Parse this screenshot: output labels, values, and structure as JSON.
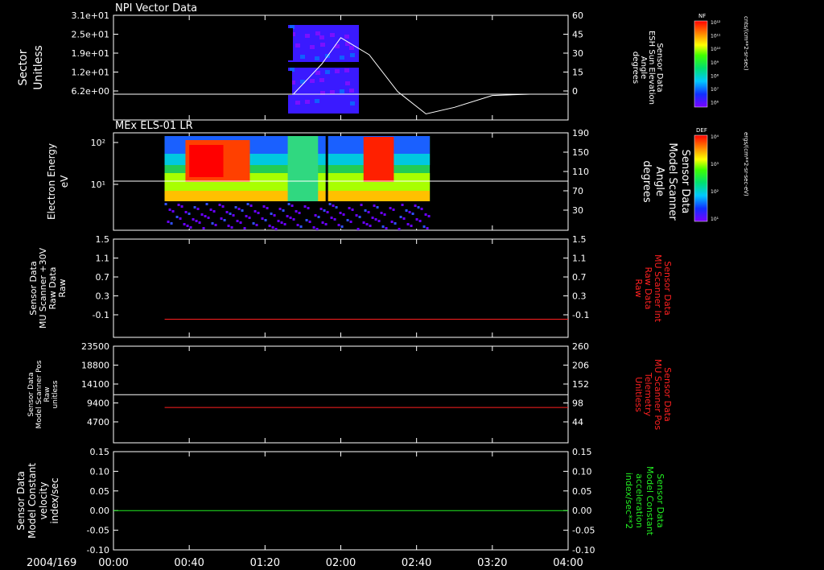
{
  "time_axis": {
    "date_label": "2004/169",
    "ticks": [
      "00:00",
      "00:40",
      "01:20",
      "02:00",
      "02:40",
      "03:20",
      "04:00"
    ]
  },
  "chart_data": [
    {
      "type": "heatmap",
      "title": "NPI Vector Data",
      "ylabel": [
        "Sector",
        "Unitless"
      ],
      "y_ticks": [
        "3.1e+01",
        "2.5e+01",
        "1.9e+01",
        "1.2e+01",
        "6.2e+00"
      ],
      "right_label": [
        "Sensor Data",
        "ESH Sun Elevation",
        "Angle",
        "degrees"
      ],
      "right_ticks": [
        "60",
        "45",
        "30",
        "15",
        "0"
      ],
      "right_ylim": [
        -20,
        60
      ],
      "overlay_series": [
        {
          "x": [
            "00:00",
            "01:35",
            "01:50",
            "02:00",
            "02:15",
            "02:30",
            "02:45",
            "03:00",
            "03:20",
            "03:40",
            "04:00"
          ],
          "y": [
            0,
            0,
            23,
            43,
            30,
            2,
            -15,
            -10,
            -1,
            0,
            0
          ]
        }
      ],
      "colorbar": {
        "label": "NF",
        "units": "cnts/(cm**2-sr-sec)",
        "ticks": [
          "10¹²",
          "10¹¹",
          "10¹⁰",
          "10⁹",
          "10⁸",
          "10⁷",
          "10⁶"
        ]
      }
    },
    {
      "type": "heatmap",
      "title": "MEx ELS-01 LR",
      "ylabel": [
        "Electron Energy",
        "eV"
      ],
      "y_ticks": [
        "10²",
        "10¹"
      ],
      "ylim": [
        1,
        200
      ],
      "right_label": [
        "Sensor Data",
        "Model Scanner",
        "Angle",
        "degrees"
      ],
      "right_ticks": [
        "190",
        "150",
        "110",
        "70",
        "30"
      ],
      "colorbar": {
        "label": "DEF",
        "units": "ergs/(cm**2-sr-sec-eV)",
        "ticks": [
          "10⁴",
          "10³",
          "10²",
          "10¹"
        ]
      }
    },
    {
      "type": "line",
      "ylabel": [
        "Sensor Data",
        "MU Scanner +30V",
        "Raw Data",
        "Raw"
      ],
      "y_ticks": [
        "1.5",
        "1.1",
        "0.7",
        "0.3",
        "-0.1"
      ],
      "ylim": [
        -0.4,
        1.5
      ],
      "right_label": [
        "Sensor Data",
        "MU Scanner Int",
        "Raw Data",
        "Raw"
      ],
      "right_ticks": [
        "1.5",
        "1.1",
        "0.7",
        "0.3",
        "-0.1"
      ],
      "series": [
        {
          "color": "#ff2020",
          "x": [
            "00:27",
            "04:00"
          ],
          "y": [
            -0.05,
            -0.05
          ]
        }
      ]
    },
    {
      "type": "line",
      "ylabel": [
        "Sensor Data",
        "Model Scanner Pos",
        "Raw",
        "unitless"
      ],
      "y_ticks": [
        "23500",
        "18800",
        "14100",
        "9400",
        "4700"
      ],
      "ylim": [
        0,
        23500
      ],
      "right_label": [
        "Sensor Data",
        "MU Scanner Pos",
        "Telemetry",
        "Unitless"
      ],
      "right_ticks": [
        "260",
        "206",
        "152",
        "98",
        "44"
      ],
      "series": [
        {
          "color": "#ffffff",
          "x": [
            "00:00",
            "04:00"
          ],
          "y": [
            11700,
            11700
          ]
        },
        {
          "color": "#ff2020",
          "x": [
            "00:27",
            "04:00"
          ],
          "y": [
            8600,
            8600
          ]
        }
      ]
    },
    {
      "type": "line",
      "ylabel": [
        "Sensor Data",
        "Model Constant",
        "velocity",
        "index/sec"
      ],
      "y_ticks": [
        "0.15",
        "0.10",
        "0.05",
        "0.00",
        "-0.05",
        "-0.10"
      ],
      "ylim": [
        -0.1,
        0.15
      ],
      "right_label": [
        "Sensor Data",
        "Model Constant",
        "acceleration",
        "index/sec**2"
      ],
      "right_ticks": [
        "0.15",
        "0.10",
        "0.05",
        "0.00",
        "-0.05",
        "-0.10"
      ],
      "series": [
        {
          "color": "#22ee22",
          "x": [
            "00:00",
            "04:00"
          ],
          "y": [
            0.0,
            0.0
          ]
        }
      ]
    }
  ]
}
